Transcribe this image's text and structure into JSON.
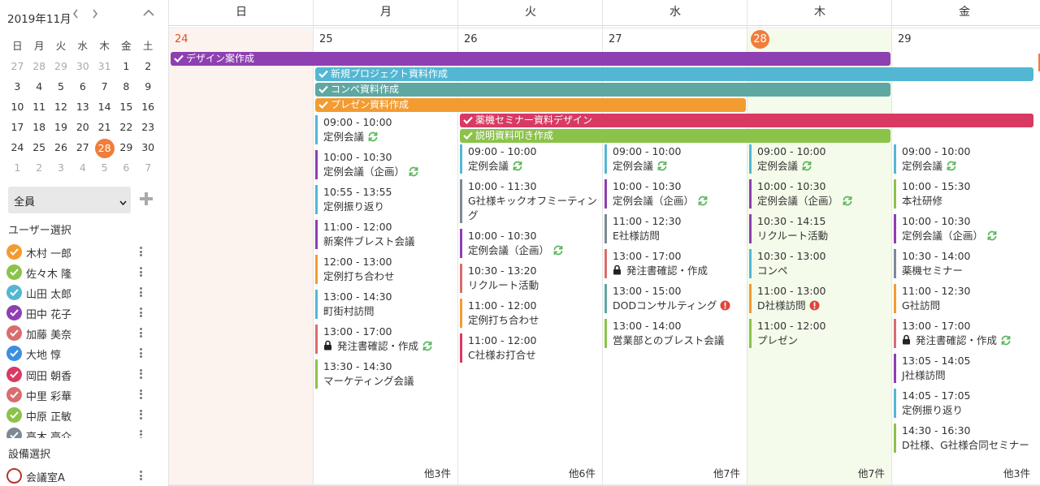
{
  "colors": {
    "accent": "#f07d3b",
    "purple": "#8e3fb1",
    "cyan": "#53b7d3",
    "teal": "#5fa7a3",
    "orange": "#f39b31",
    "pink": "#d83a63",
    "green": "#8bc34a",
    "gray": "#7d8a93",
    "red": "#d96d6d",
    "blue": "#3c8fe0",
    "today_bg": "#f4fbea",
    "sunday_bg": "#fdf3ee"
  },
  "sidebar": {
    "mini_calendar": {
      "title": "2019年11月",
      "prev_icon": "chevron-left-icon",
      "next_icon": "chevron-right-icon",
      "collapse_icon": "chevron-up-icon",
      "weekday_headers": [
        "日",
        "月",
        "火",
        "水",
        "木",
        "金",
        "土"
      ],
      "weeks": [
        [
          {
            "d": "27",
            "out": true
          },
          {
            "d": "28",
            "out": true
          },
          {
            "d": "29",
            "out": true
          },
          {
            "d": "30",
            "out": true
          },
          {
            "d": "31",
            "out": true
          },
          {
            "d": "1"
          },
          {
            "d": "2"
          }
        ],
        [
          {
            "d": "3"
          },
          {
            "d": "4"
          },
          {
            "d": "5"
          },
          {
            "d": "6"
          },
          {
            "d": "7"
          },
          {
            "d": "8"
          },
          {
            "d": "9"
          }
        ],
        [
          {
            "d": "10"
          },
          {
            "d": "11"
          },
          {
            "d": "12"
          },
          {
            "d": "13"
          },
          {
            "d": "14"
          },
          {
            "d": "15"
          },
          {
            "d": "16"
          }
        ],
        [
          {
            "d": "17"
          },
          {
            "d": "18"
          },
          {
            "d": "19"
          },
          {
            "d": "20"
          },
          {
            "d": "21"
          },
          {
            "d": "22"
          },
          {
            "d": "23"
          }
        ],
        [
          {
            "d": "24"
          },
          {
            "d": "25"
          },
          {
            "d": "26"
          },
          {
            "d": "27"
          },
          {
            "d": "28",
            "today": true
          },
          {
            "d": "29"
          },
          {
            "d": "30"
          }
        ],
        [
          {
            "d": "1",
            "out": true
          },
          {
            "d": "2",
            "out": true
          },
          {
            "d": "3",
            "out": true
          },
          {
            "d": "4",
            "out": true
          },
          {
            "d": "5",
            "out": true
          },
          {
            "d": "6",
            "out": true
          },
          {
            "d": "7",
            "out": true
          }
        ]
      ]
    },
    "member_select": {
      "value": "全員"
    },
    "user_section_label": "ユーザー選択",
    "users": [
      {
        "name": "木村 一郎",
        "color": "#f39b31"
      },
      {
        "name": "佐々木 隆",
        "color": "#8bc34a"
      },
      {
        "name": "山田 太郎",
        "color": "#53b7d3"
      },
      {
        "name": "田中 花子",
        "color": "#8e3fb1"
      },
      {
        "name": "加藤 美奈",
        "color": "#d96d6d"
      },
      {
        "name": "大地 惇",
        "color": "#3c8fe0"
      },
      {
        "name": "岡田 朝香",
        "color": "#d83a63"
      },
      {
        "name": "中里 彩華",
        "color": "#d96d6d"
      },
      {
        "name": "中原 正敏",
        "color": "#8bc34a"
      },
      {
        "name": "高木 亮介",
        "color": "#7d8a93"
      }
    ],
    "facility_section_label": "設備選択",
    "facilities": [
      {
        "name": "会議室A"
      }
    ]
  },
  "calendar": {
    "weekday_headers": [
      "日",
      "月",
      "火",
      "水",
      "木",
      "金"
    ],
    "days": [
      {
        "num": "24",
        "more": ""
      },
      {
        "num": "25",
        "more": "他3件"
      },
      {
        "num": "26",
        "more": "他6件"
      },
      {
        "num": "27",
        "more": "他7件"
      },
      {
        "num": "28",
        "more": "他7件"
      },
      {
        "num": "29",
        "more": "他3件"
      }
    ],
    "allday_events": [
      {
        "title": "デザイン案作成",
        "color": "#8e3fb1",
        "start": 0,
        "end": 5,
        "row": 0
      },
      {
        "title": "新規プロジェクト資料作成",
        "color": "#53b7d3",
        "start": 1,
        "end": 6,
        "row": 1
      },
      {
        "title": "コンペ資料作成",
        "color": "#5fa7a3",
        "start": 1,
        "end": 5,
        "row": 2
      },
      {
        "title": "プレゼン資料作成",
        "color": "#f39b31",
        "start": 1,
        "end": 4,
        "row": 3
      },
      {
        "title": "薬機セミナー資料デザイン",
        "color": "#d83a63",
        "start": 2,
        "end": 6,
        "row": 4
      },
      {
        "title": "説明資料叩き作成",
        "color": "#8bc34a",
        "start": 2,
        "end": 5,
        "row": 5
      }
    ],
    "timed_events": [
      [],
      [
        {
          "time": "09:00 - 10:00",
          "title": "定例会議",
          "color": "#53b7d3",
          "repeat": true
        },
        {
          "time": "10:00 - 10:30",
          "title": "定例会議（企画）",
          "color": "#8e3fb1",
          "repeat": true
        },
        {
          "time": "10:55 - 13:55",
          "title": "定例振り返り",
          "color": "#53b7d3"
        },
        {
          "time": "11:00 - 12:00",
          "title": "新案件ブレスト会議",
          "color": "#8e3fb1"
        },
        {
          "time": "12:00 - 13:00",
          "title": "定例打ち合わせ",
          "color": "#f39b31"
        },
        {
          "time": "13:00 - 14:30",
          "title": "町街村訪問",
          "color": "#53b7d3"
        },
        {
          "time": "13:00 - 17:00",
          "title": "発注書確認・作成",
          "color": "#d96d6d",
          "lock": true,
          "repeat": true
        },
        {
          "time": "13:30 - 14:30",
          "title": "マーケティング会議",
          "color": "#8bc34a"
        }
      ],
      [
        {
          "time": "09:00 - 10:00",
          "title": "定例会議",
          "color": "#53b7d3",
          "repeat": true
        },
        {
          "time": "10:00 - 11:30",
          "title": "G社様キックオフミーティング",
          "color": "#7d8a93"
        },
        {
          "time": "10:00 - 10:30",
          "title": "定例会議（企画）",
          "color": "#8e3fb1",
          "repeat": true
        },
        {
          "time": "10:30 - 13:20",
          "title": "リクルート活動",
          "color": "#d96d6d"
        },
        {
          "time": "11:00 - 12:00",
          "title": "定例打ち合わせ",
          "color": "#f39b31"
        },
        {
          "time": "11:00 - 12:00",
          "title": "C社様お打合せ",
          "color": "#d83a63"
        }
      ],
      [
        {
          "time": "09:00 - 10:00",
          "title": "定例会議",
          "color": "#53b7d3",
          "repeat": true
        },
        {
          "time": "10:00 - 10:30",
          "title": "定例会議（企画）",
          "color": "#8e3fb1",
          "repeat": true
        },
        {
          "time": "11:00 - 12:30",
          "title": "E社様訪問",
          "color": "#7d8a93"
        },
        {
          "time": "13:00 - 17:00",
          "title": "発注書確認・作成",
          "color": "#d96d6d",
          "lock": true
        },
        {
          "time": "13:00 - 15:00",
          "title": "DODコンサルティング",
          "color": "#5fa7a3",
          "alert": true
        },
        {
          "time": "13:00 - 14:00",
          "title": "営業部とのブレスト会議",
          "color": "#8bc34a"
        }
      ],
      [
        {
          "time": "09:00 - 10:00",
          "title": "定例会議",
          "color": "#53b7d3",
          "repeat": true
        },
        {
          "time": "10:00 - 10:30",
          "title": "定例会議（企画）",
          "color": "#8e3fb1",
          "repeat": true
        },
        {
          "time": "10:30 - 14:15",
          "title": "リクルート活動",
          "color": "#8e3fb1"
        },
        {
          "time": "10:30 - 13:00",
          "title": "コンペ",
          "color": "#53b7d3"
        },
        {
          "time": "11:00 - 13:00",
          "title": "D社様訪問",
          "color": "#f39b31",
          "alert": true
        },
        {
          "time": "11:00 - 12:00",
          "title": "プレゼン",
          "color": "#8bc34a"
        }
      ],
      [
        {
          "time": "09:00 - 10:00",
          "title": "定例会議",
          "color": "#53b7d3",
          "repeat": true
        },
        {
          "time": "10:00 - 15:30",
          "title": "本社研修",
          "color": "#8bc34a"
        },
        {
          "time": "10:00 - 10:30",
          "title": "定例会議（企画）",
          "color": "#8e3fb1",
          "repeat": true
        },
        {
          "time": "10:30 - 14:00",
          "title": "薬機セミナー",
          "color": "#7d8a93"
        },
        {
          "time": "11:00 - 12:30",
          "title": "G社訪問",
          "color": "#f39b31"
        },
        {
          "time": "13:00 - 17:00",
          "title": "発注書確認・作成",
          "color": "#d96d6d",
          "lock": true,
          "repeat": true
        },
        {
          "time": "13:05 - 14:05",
          "title": "J社様訪問",
          "color": "#8e3fb1"
        },
        {
          "time": "14:05 - 17:05",
          "title": "定例振り返り",
          "color": "#53b7d3"
        },
        {
          "time": "14:30 - 16:30",
          "title": "D社様、G社様合同セミナー",
          "color": "#8bc34a"
        }
      ]
    ]
  }
}
